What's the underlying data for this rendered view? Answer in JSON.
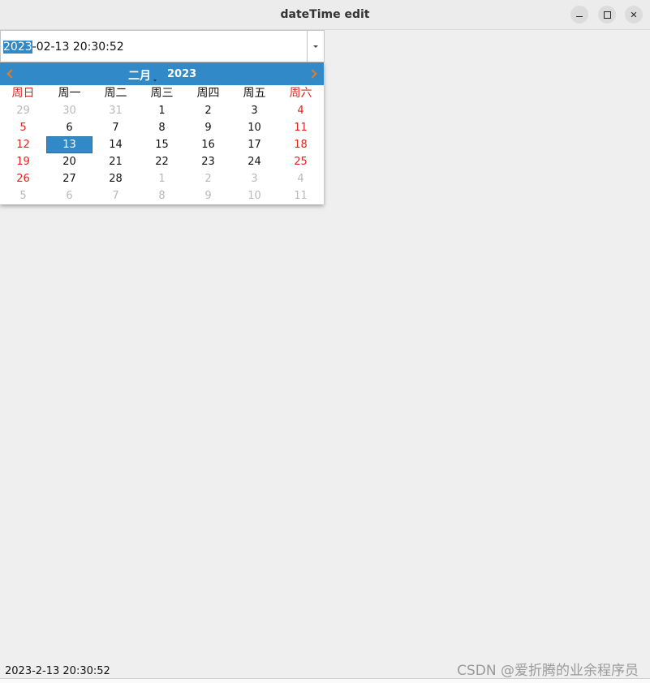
{
  "window": {
    "title": "dateTime edit"
  },
  "datetime_edit": {
    "selected_part": "2023",
    "rest_text": "-02-13 20:30:52"
  },
  "calendar": {
    "month_label": "二月",
    "year_label": "2023",
    "weekday_headers": [
      "周日",
      "周一",
      "周二",
      "周三",
      "周四",
      "周五",
      "周六"
    ],
    "weeks": [
      [
        "29",
        "30",
        "31",
        "1",
        "2",
        "3",
        "4"
      ],
      [
        "5",
        "6",
        "7",
        "8",
        "9",
        "10",
        "11"
      ],
      [
        "12",
        "13",
        "14",
        "15",
        "16",
        "17",
        "18"
      ],
      [
        "19",
        "20",
        "21",
        "22",
        "23",
        "24",
        "25"
      ],
      [
        "26",
        "27",
        "28",
        "1",
        "2",
        "3",
        "4"
      ],
      [
        "5",
        "6",
        "7",
        "8",
        "9",
        "10",
        "11"
      ]
    ],
    "selected_day": "13",
    "accent_color": "#3289c8",
    "weekend_color": "#e0241b",
    "arrow_color": "#ef7a1a"
  },
  "status_label": "2023-2-13  20:30:52",
  "watermark": "CSDN @爱折腾的业余程序员",
  "icons": {
    "prev": "chevron-left-icon",
    "next": "chevron-right-icon",
    "dropdown": "dropdown-arrow-icon",
    "minimize": "minimize-icon",
    "maximize": "maximize-icon",
    "close": "close-icon"
  }
}
